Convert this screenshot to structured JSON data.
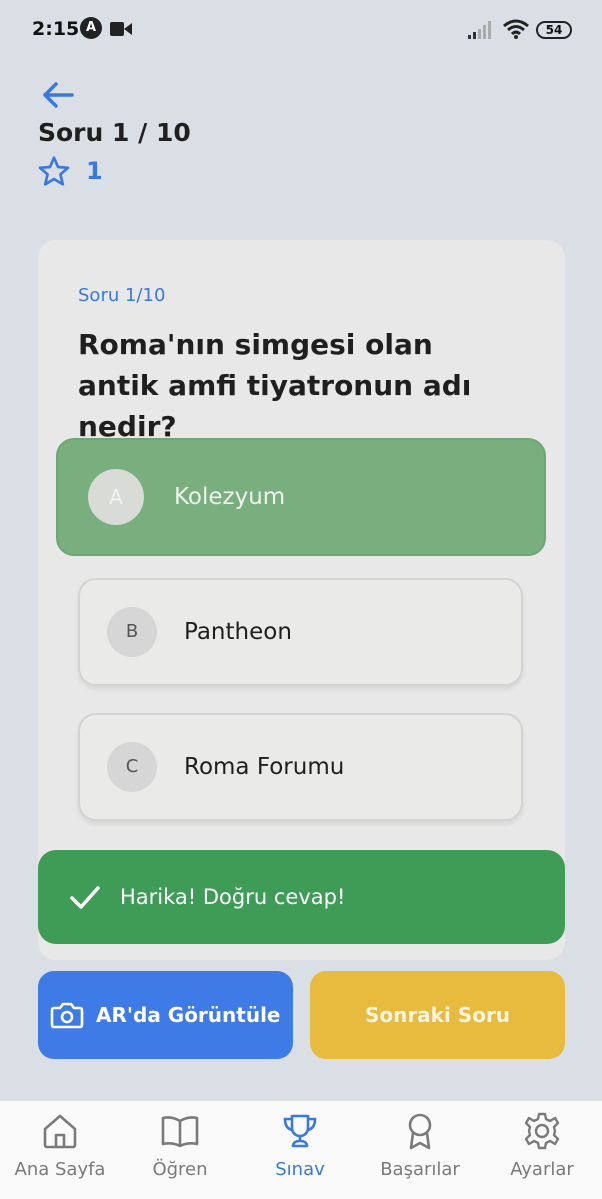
{
  "status_bar": {
    "time": "2:15",
    "a_badge": "A",
    "battery": "54"
  },
  "header": {
    "question_counter": "Soru 1 / 10",
    "star_count": "1"
  },
  "question": {
    "label": "Soru 1/10",
    "text": "Roma'nın simgesi olan antik amfi tiyatronun adı nedir?",
    "options": [
      {
        "letter": "A",
        "text": "Kolezyum",
        "state": "correct"
      },
      {
        "letter": "B",
        "text": "Pantheon",
        "state": "normal"
      },
      {
        "letter": "C",
        "text": "Roma Forumu",
        "state": "normal"
      }
    ]
  },
  "feedback": {
    "text": "Harika! Doğru cevap!"
  },
  "actions": {
    "ar_label": "AR'da Görüntüle",
    "next_label": "Sonraki Soru"
  },
  "nav": {
    "items": [
      {
        "label": "Ana Sayfa",
        "icon": "home-icon"
      },
      {
        "label": "Öğren",
        "icon": "book-icon"
      },
      {
        "label": "Sınav",
        "icon": "trophy-icon",
        "active": true
      },
      {
        "label": "Başarılar",
        "icon": "award-icon"
      },
      {
        "label": "Ayarlar",
        "icon": "gear-icon"
      }
    ]
  },
  "colors": {
    "accent": "#3a78e0",
    "correct": "#79ae7e",
    "feedback": "#3e9c56",
    "ar_button": "#3e7be6",
    "next_button": "#e6bb3e",
    "background": "#d9dfe4"
  }
}
